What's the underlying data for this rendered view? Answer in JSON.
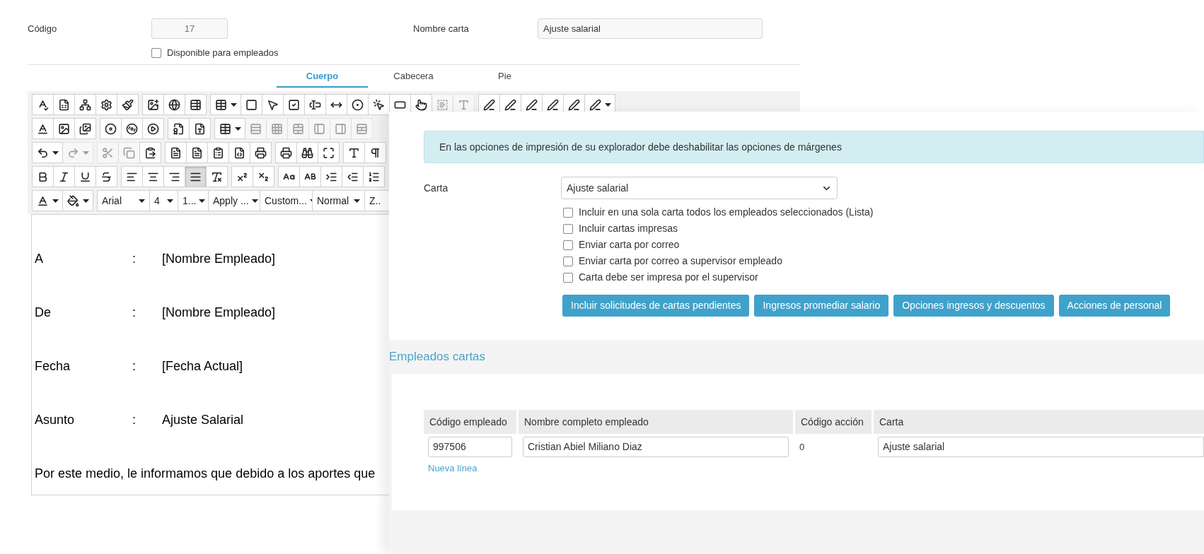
{
  "form": {
    "codigo": {
      "label": "Código",
      "value": "17",
      "disabled": true
    },
    "disponible": {
      "label": "Disponible para empleados",
      "checked": false
    },
    "nombre_carta": {
      "label": "Nombre carta",
      "value": "Ajuste salarial"
    }
  },
  "tabs": [
    {
      "label": "Cuerpo",
      "selected": true
    },
    {
      "label": "Cabecera",
      "selected": false
    },
    {
      "label": "Pie",
      "selected": false
    }
  ],
  "editor": {
    "toolbar": {
      "rows": [
        [
          [
            {
              "kind": "icon",
              "disabled": false,
              "active": false
            },
            {
              "kind": "icon",
              "disabled": false,
              "active": false
            },
            {
              "kind": "icon",
              "disabled": false,
              "active": false
            },
            {
              "kind": "icon",
              "disabled": false,
              "active": false
            },
            {
              "kind": "icon",
              "disabled": false,
              "active": false
            }
          ],
          [
            {
              "kind": "icon",
              "disabled": false,
              "active": false
            },
            {
              "kind": "icon",
              "disabled": false,
              "active": false
            },
            {
              "kind": "icon",
              "disabled": false,
              "active": false
            }
          ],
          [
            {
              "kind": "menu",
              "disabled": false,
              "active": false
            },
            {
              "kind": "icon",
              "disabled": false,
              "active": false
            },
            {
              "kind": "icon",
              "disabled": false,
              "active": false
            },
            {
              "kind": "icon",
              "disabled": false,
              "active": false
            },
            {
              "kind": "icon",
              "disabled": false,
              "active": false
            },
            {
              "kind": "icon",
              "disabled": false,
              "active": false
            },
            {
              "kind": "icon",
              "disabled": false,
              "active": false
            },
            {
              "kind": "icon",
              "disabled": false,
              "active": false
            },
            {
              "kind": "icon",
              "disabled": false,
              "active": false
            },
            {
              "kind": "icon",
              "disabled": false,
              "active": false
            },
            {
              "kind": "icon",
              "disabled": true,
              "active": false
            },
            {
              "kind": "icon",
              "disabled": true,
              "active": false
            }
          ],
          [
            {
              "kind": "icon",
              "disabled": false,
              "active": false
            },
            {
              "kind": "icon",
              "disabled": false,
              "active": false
            },
            {
              "kind": "icon",
              "disabled": false,
              "active": false
            },
            {
              "kind": "icon",
              "disabled": false,
              "active": false
            },
            {
              "kind": "icon",
              "disabled": false,
              "active": false
            },
            {
              "kind": "menu",
              "disabled": false,
              "active": false
            }
          ]
        ],
        [
          [
            {
              "kind": "icon",
              "disabled": false,
              "active": false
            },
            {
              "kind": "icon",
              "disabled": false,
              "active": false
            },
            {
              "kind": "icon",
              "disabled": false,
              "active": false
            }
          ],
          [
            {
              "kind": "icon",
              "disabled": false,
              "active": false
            },
            {
              "kind": "icon",
              "disabled": false,
              "active": false
            },
            {
              "kind": "icon",
              "disabled": false,
              "active": false
            }
          ],
          [
            {
              "kind": "icon",
              "disabled": false,
              "active": false
            },
            {
              "kind": "icon",
              "disabled": false,
              "active": false
            }
          ],
          [
            {
              "kind": "menu",
              "disabled": false,
              "active": false
            },
            {
              "kind": "icon",
              "disabled": true,
              "active": false
            },
            {
              "kind": "icon",
              "disabled": true,
              "active": false
            },
            {
              "kind": "icon",
              "disabled": true,
              "active": false
            },
            {
              "kind": "icon",
              "disabled": true,
              "active": false
            },
            {
              "kind": "icon",
              "disabled": true,
              "active": false
            },
            {
              "kind": "icon",
              "disabled": true,
              "active": false
            }
          ]
        ],
        [
          [
            {
              "kind": "menu",
              "disabled": false,
              "active": false
            },
            {
              "kind": "menu",
              "disabled": true,
              "active": false
            }
          ],
          [
            {
              "kind": "icon",
              "disabled": true,
              "active": false
            },
            {
              "kind": "icon",
              "disabled": true,
              "active": false
            },
            {
              "kind": "icon",
              "disabled": false,
              "active": false
            }
          ],
          [
            {
              "kind": "icon",
              "disabled": false,
              "active": false
            },
            {
              "kind": "icon",
              "disabled": false,
              "active": false
            },
            {
              "kind": "icon",
              "disabled": false,
              "active": false
            },
            {
              "kind": "icon",
              "disabled": false,
              "active": false
            },
            {
              "kind": "icon",
              "disabled": false,
              "active": false
            }
          ],
          [
            {
              "kind": "icon",
              "disabled": false,
              "active": false
            },
            {
              "kind": "icon",
              "disabled": false,
              "active": false
            },
            {
              "kind": "icon",
              "disabled": false,
              "active": false
            }
          ],
          [
            {
              "kind": "icon",
              "disabled": false,
              "active": false
            },
            {
              "kind": "icon",
              "disabled": false,
              "active": false
            }
          ]
        ],
        [
          [
            {
              "kind": "icon",
              "disabled": false,
              "active": false
            },
            {
              "kind": "icon",
              "disabled": false,
              "active": false
            },
            {
              "kind": "icon",
              "disabled": false,
              "active": false
            },
            {
              "kind": "icon",
              "disabled": false,
              "active": false
            }
          ],
          [
            {
              "kind": "icon",
              "disabled": false,
              "active": false
            },
            {
              "kind": "icon",
              "disabled": false,
              "active": false
            },
            {
              "kind": "icon",
              "disabled": false,
              "active": false
            },
            {
              "kind": "icon",
              "disabled": false,
              "active": true
            },
            {
              "kind": "icon",
              "disabled": false,
              "active": false
            }
          ],
          [
            {
              "kind": "icon",
              "disabled": false,
              "active": false
            },
            {
              "kind": "icon",
              "disabled": false,
              "active": false
            }
          ],
          [
            {
              "kind": "icon",
              "disabled": false,
              "active": false
            },
            {
              "kind": "icon",
              "disabled": false,
              "active": false
            },
            {
              "kind": "icon",
              "disabled": false,
              "active": false
            },
            {
              "kind": "icon",
              "disabled": false,
              "active": false
            },
            {
              "kind": "icon",
              "disabled": false,
              "active": false
            }
          ]
        ],
        [
          [
            {
              "kind": "menu",
              "disabled": false,
              "active": false
            },
            {
              "kind": "menu",
              "disabled": false,
              "active": false
            }
          ],
          [
            {
              "kind": "select",
              "label": "Arial"
            },
            {
              "kind": "select",
              "label": "4"
            },
            {
              "kind": "select",
              "label": "1..."
            },
            {
              "kind": "select",
              "label": "Apply ..."
            },
            {
              "kind": "select",
              "label": "Custom..."
            },
            {
              "kind": "select",
              "label": "Normal"
            },
            {
              "kind": "select",
              "label": "Z.."
            }
          ]
        ]
      ]
    },
    "lines": [
      {
        "label": "A",
        "separator": ":",
        "value": "[Nombre Empleado]"
      },
      {
        "label": "De",
        "separator": ":",
        "value": "[Nombre Empleado]"
      },
      {
        "label": "Fecha",
        "separator": ":",
        "value": "[Fecha Actual]"
      },
      {
        "label": "Asunto",
        "separator": ":",
        "value": "Ajuste Salarial"
      }
    ],
    "paragraph": "Por este medio, le informamos que debido a los aportes que"
  },
  "print_panel": {
    "alert": "En las opciones de impresión de su explorador debe deshabilitar las opciones de márgenes",
    "carta": {
      "label": "Carta",
      "value": "Ajuste salarial"
    },
    "options": [
      {
        "label": "Incluir en una sola carta todos los empleados seleccionados (Lista)",
        "checked": false
      },
      {
        "label": "Incluir cartas impresas",
        "checked": false
      },
      {
        "label": "Enviar carta por correo",
        "checked": false
      },
      {
        "label": "Enviar carta por correo a supervisor empleado",
        "checked": false
      },
      {
        "label": "Carta debe ser impresa por el supervisor",
        "checked": false
      }
    ],
    "buttons": [
      "Incluir solicitudes de cartas pendientes",
      "Ingresos promediar salario",
      "Opciones ingresos y descuentos",
      "Acciones de personal"
    ]
  },
  "empleados": {
    "title": "Empleados cartas",
    "columns": [
      "Código empleado",
      "Nombre completo empleado",
      "Código acción",
      "Carta"
    ],
    "rows": [
      {
        "codigo_empleado": "997506",
        "nombre": "Cristian Abiel Miliano Diaz",
        "codigo_accion": "0",
        "carta": "Ajuste salarial"
      }
    ],
    "add_link": "Nueva línea"
  }
}
